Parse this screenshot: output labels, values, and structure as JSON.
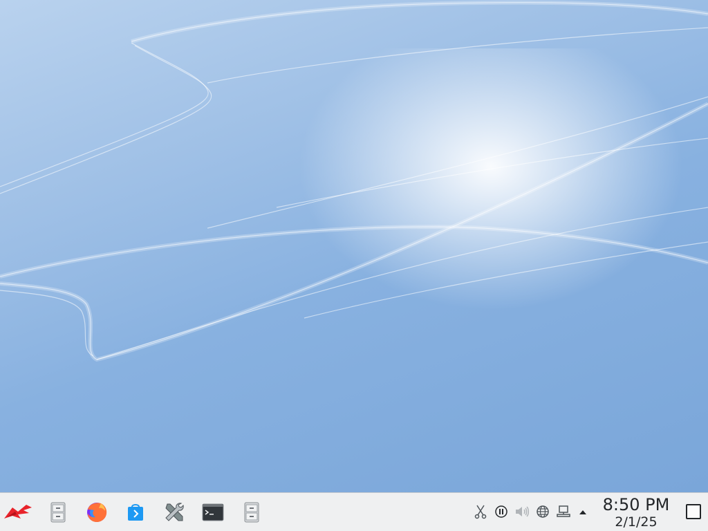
{
  "desktop": {
    "wallpaper": "kde-blue-waves"
  },
  "taskbar": {
    "launchers": [
      {
        "id": "app-menu",
        "icon": "kde-launcher-icon"
      },
      {
        "id": "file-manager",
        "icon": "file-cabinet-icon"
      },
      {
        "id": "firefox",
        "icon": "firefox-icon"
      },
      {
        "id": "discover",
        "icon": "store-bag-icon"
      },
      {
        "id": "system-settings",
        "icon": "tools-icon"
      },
      {
        "id": "terminal",
        "icon": "terminal-icon"
      },
      {
        "id": "file-manager-2",
        "icon": "file-cabinet-icon"
      }
    ],
    "tray": [
      {
        "id": "clipboard",
        "icon": "scissors-icon"
      },
      {
        "id": "media",
        "icon": "pause-icon"
      },
      {
        "id": "volume",
        "icon": "speaker-icon"
      },
      {
        "id": "updates",
        "icon": "globe-icon"
      },
      {
        "id": "network",
        "icon": "network-wired-icon"
      },
      {
        "id": "expand",
        "icon": "chevron-up-icon"
      }
    ],
    "clock": {
      "time": "8:50 PM",
      "date": "2/1/25"
    }
  },
  "colors": {
    "panel_bg": "#eff0f1",
    "text": "#232629",
    "accent": "#3daee9"
  }
}
